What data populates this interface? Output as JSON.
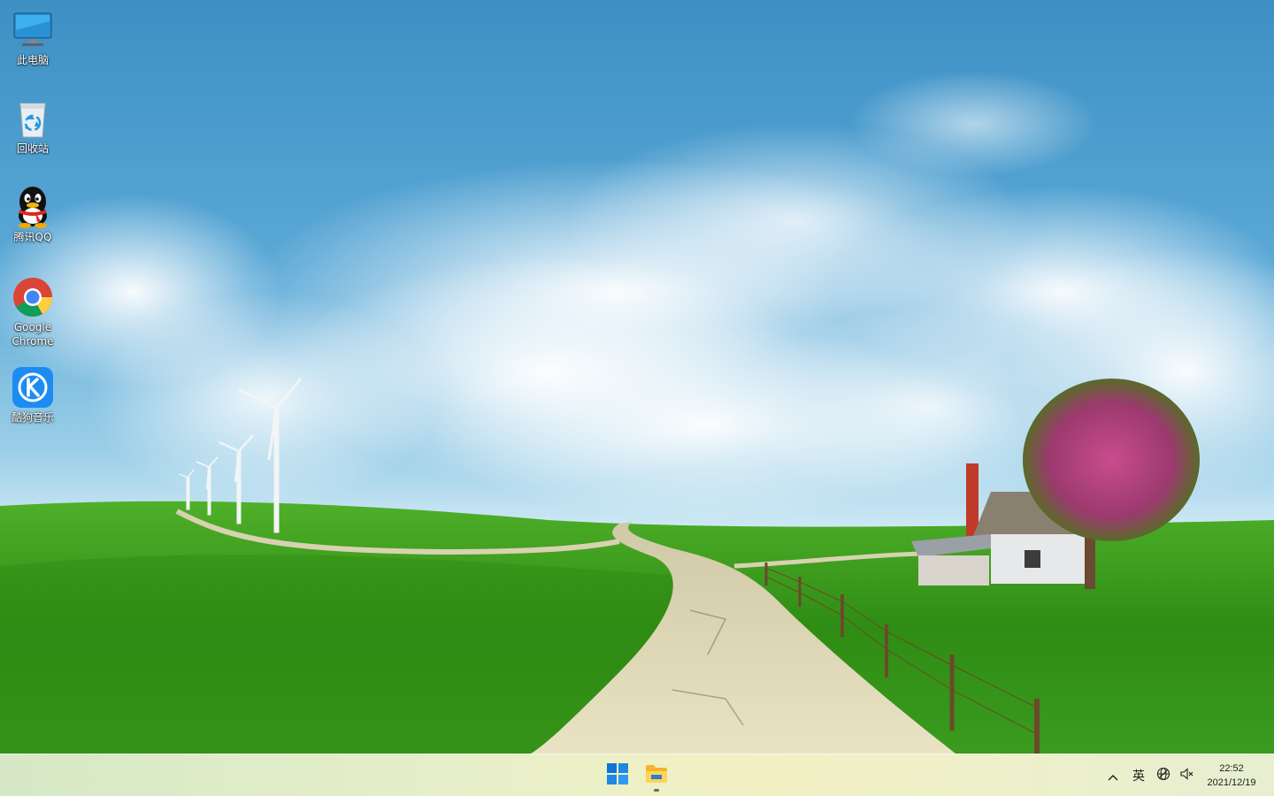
{
  "desktop": {
    "icons": [
      {
        "label": "此电脑",
        "icon": "this-pc-icon"
      },
      {
        "label": "回收站",
        "icon": "recycle-bin-icon"
      },
      {
        "label": "腾讯QQ",
        "icon": "qq-icon"
      },
      {
        "label": "Google Chrome",
        "icon": "chrome-icon"
      },
      {
        "label": "酷狗音乐",
        "icon": "kugou-music-icon"
      }
    ]
  },
  "taskbar": {
    "pinned": [
      {
        "name": "start",
        "icon": "windows-logo-icon"
      },
      {
        "name": "file-explorer",
        "icon": "folder-icon",
        "running": true
      }
    ],
    "tray": {
      "chevron_icon": "chevron-up-icon",
      "ime_label": "英",
      "network_icon": "globe-icon",
      "volume_icon": "volume-muted-icon",
      "time": "22:52",
      "date": "2021/12/19"
    }
  },
  "colors": {
    "sky_top": "#3f93c6",
    "grass": "#3a9a1c",
    "path": "#dcd6b2",
    "windows_blue": "#0a74d8",
    "kugou_blue": "#1d8cf2"
  }
}
